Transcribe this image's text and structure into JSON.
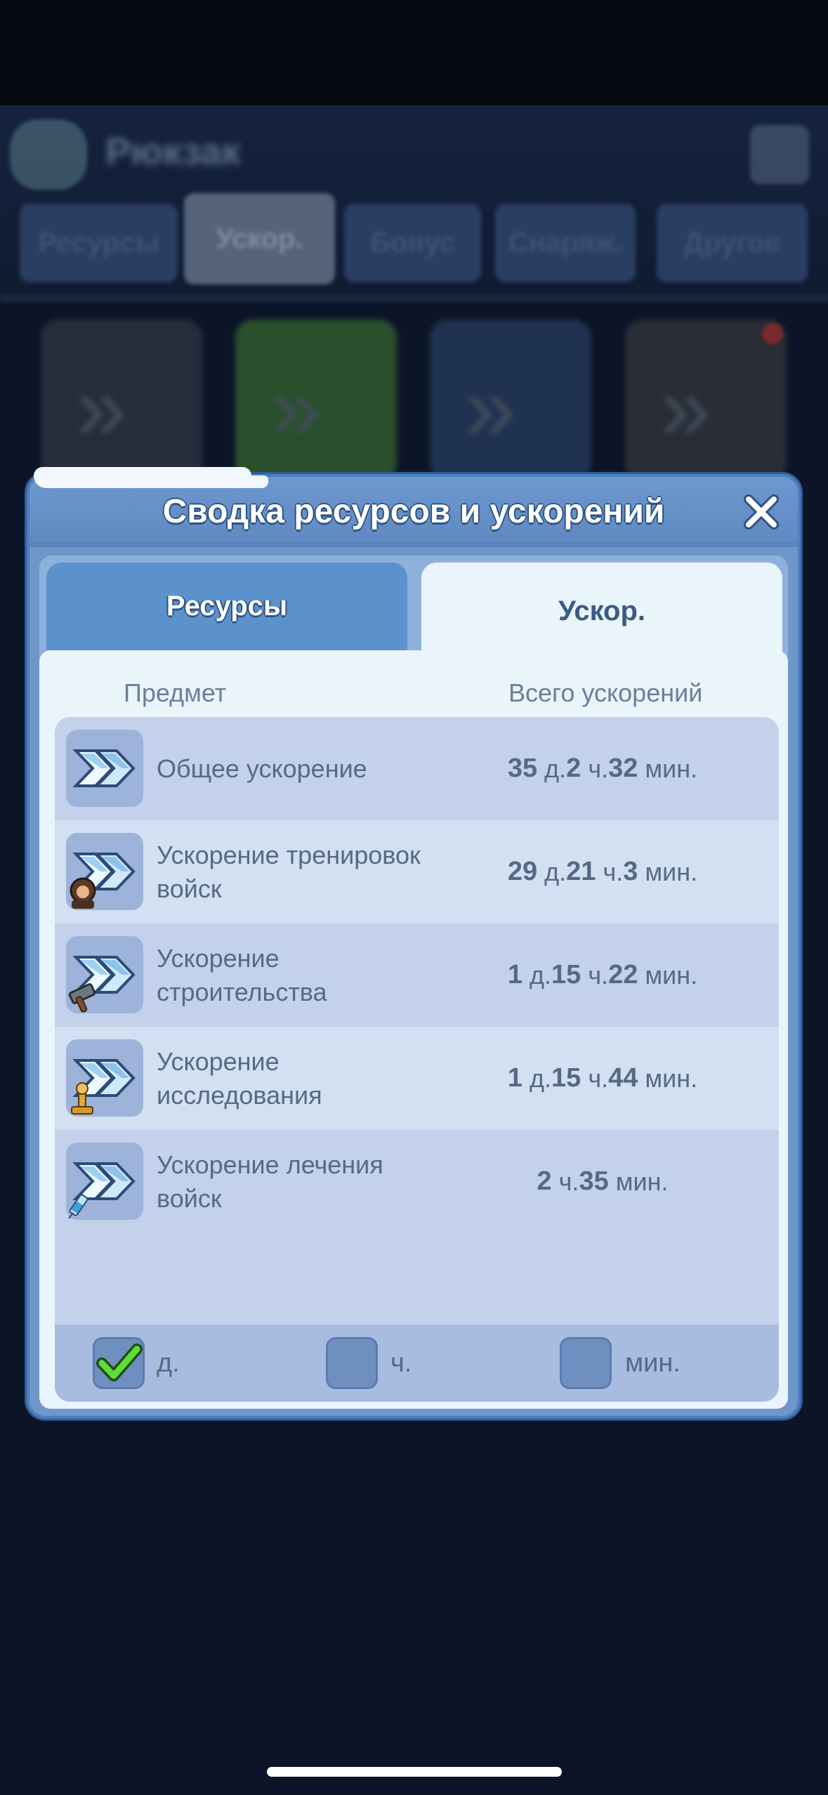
{
  "background": {
    "title": "Рюкзак",
    "tabs": [
      "Ресурсы",
      "Ускор.",
      "Бонус",
      "Снаряж.",
      "Другое"
    ]
  },
  "modal": {
    "title": "Сводка ресурсов и ускорений",
    "tabs": [
      {
        "label": "Ресурсы",
        "active": false
      },
      {
        "label": "Ускор.",
        "active": true
      }
    ],
    "columns": {
      "item": "Предмет",
      "total": "Всего ускорений"
    },
    "rows": [
      {
        "icon": "general-speedup-icon",
        "label": "Общее ускорение",
        "value": [
          {
            "n": "35",
            "u": "д."
          },
          {
            "n": "2",
            "u": "ч."
          },
          {
            "n": "32",
            "u": "мин."
          }
        ]
      },
      {
        "icon": "training-speedup-icon",
        "label": "Ускорение тренировок войск",
        "value": [
          {
            "n": "29",
            "u": "д."
          },
          {
            "n": "21",
            "u": "ч."
          },
          {
            "n": "3",
            "u": "мин."
          }
        ]
      },
      {
        "icon": "construction-speedup-icon",
        "label": "Ускорение строительства",
        "value": [
          {
            "n": "1",
            "u": "д."
          },
          {
            "n": "15",
            "u": "ч."
          },
          {
            "n": "22",
            "u": "мин."
          }
        ]
      },
      {
        "icon": "research-speedup-icon",
        "label": "Ускорение исследования",
        "value": [
          {
            "n": "1",
            "u": "д."
          },
          {
            "n": "15",
            "u": "ч."
          },
          {
            "n": "44",
            "u": "мин."
          }
        ]
      },
      {
        "icon": "healing-speedup-icon",
        "label": "Ускорение лечения войск",
        "value": [
          {
            "n": "2",
            "u": "ч."
          },
          {
            "n": "35",
            "u": "мин."
          }
        ]
      }
    ],
    "filters": [
      {
        "label": "д.",
        "checked": true
      },
      {
        "label": "ч.",
        "checked": false
      },
      {
        "label": "мин.",
        "checked": false
      }
    ]
  }
}
